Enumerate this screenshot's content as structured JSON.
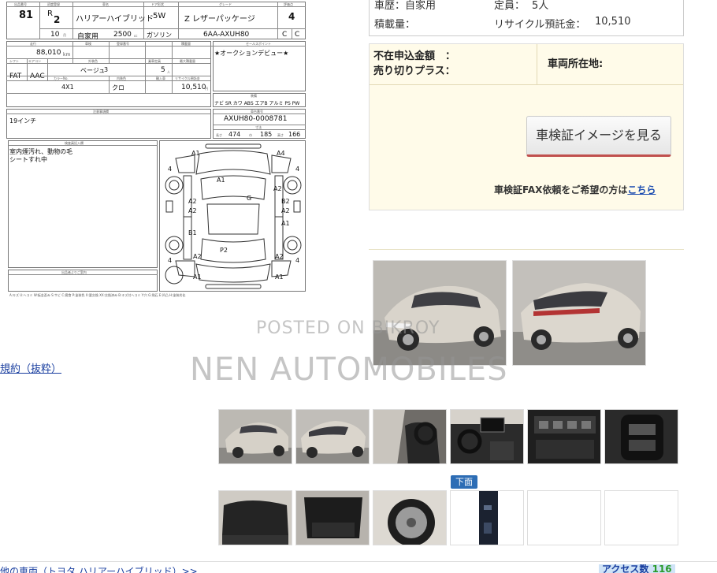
{
  "sheet": {
    "header_labels": [
      "出品番号",
      "初度登録",
      "車名",
      "ドア形状",
      "グレード",
      "評価点"
    ],
    "lot_no": "81",
    "era": "R",
    "year": "2",
    "month": "10",
    "unit_month": "月",
    "car_name": "ハリアーハイブリッド",
    "door": "5W",
    "grade": "Z レザーパッケージ",
    "score": "4",
    "usage": "自家用",
    "displacement": "2500",
    "displacement_unit": "cc",
    "fuel": "ガソリン",
    "model_code": "6AA-AXUH80",
    "interior_grade": "C",
    "exterior_grade": "C",
    "row2_labels": [
      "走行",
      "車検",
      "登録番号",
      "積載量",
      "セールスポイント"
    ],
    "mileage": "88,010",
    "mileage_unit": "km",
    "sales_point": "★オークションデビュー★",
    "row3_labels": [
      "シフト",
      "エアコン",
      "外装色",
      "乗車定員",
      "最大積載量"
    ],
    "shift": "FAT",
    "aircon": "AAC",
    "exterior_color": "ベージュ",
    "color_no": "3",
    "seats": "5",
    "seats_unit": "人",
    "row4_labels": [
      "カラーNo.",
      "内装色",
      "輸入車",
      "リサイクル預託金"
    ],
    "drive": "4X1",
    "interior_color": "クロ",
    "recycle": "10,510",
    "recycle_unit": "円",
    "equip_label": "装備",
    "equipment": "ナビ SR カワ ABS エアB アルミ PS PW",
    "note_label": "注意事項欄",
    "note": "19インチ",
    "chassis_label": "車台番号",
    "chassis": "AXUH80-0008781",
    "size_label": "寸法",
    "length_label": "長さ",
    "length": "474",
    "width_label": "巾",
    "width": "185",
    "height_label": "高さ",
    "height": "166",
    "inspection_label": "検査員記入欄",
    "inspection": "室内煙汚れ、動物の毛\nシートすれ中",
    "seller_label": "出品者よりご案内",
    "legend": "A:キズ U:ヘコミ W:板金歪み S:サビ C:腐食 P:塗装色 X:要交換 XX:交換済み B:キズ付ヘコミ Y:穴 G:飛石 E:凹凸 H:塗装劣化"
  },
  "diagram": {
    "marks": [
      "A1",
      "A4",
      "A1",
      "A2",
      "G",
      "A2",
      "B2",
      "A2",
      "A2",
      "A1",
      "B1",
      "A2",
      "P2",
      "A2",
      "A1",
      "A1"
    ],
    "tire_labels": [
      "4",
      "4",
      "4",
      "4"
    ]
  },
  "info": {
    "history_label": "車歴：自家用",
    "capacity_label": "定員：",
    "capacity_value": "5人",
    "load_label": "積載量：",
    "recycle_label": "リサイクル預託金：",
    "recycle_value": "10,510",
    "amount_label": "不在申込金額　：",
    "outright_label": "売り切りプラス：",
    "location_label": "車両所在地:",
    "shaken_button": "車検証イメージを見る",
    "fax_text": "車検証FAX依頼をご希望の方は",
    "fax_link": "こちら"
  },
  "rules_link": "規約（抜粋）",
  "watermark_small": "POSTED ON BIKROY",
  "watermark_big": "NEN AUTOMOBILES",
  "under_badge": "下面",
  "bottom": {
    "other_cars": "他の車両（トヨタ ハリアーハイブリッド）>>",
    "access_label": "アクセス数",
    "access_count": "116"
  }
}
